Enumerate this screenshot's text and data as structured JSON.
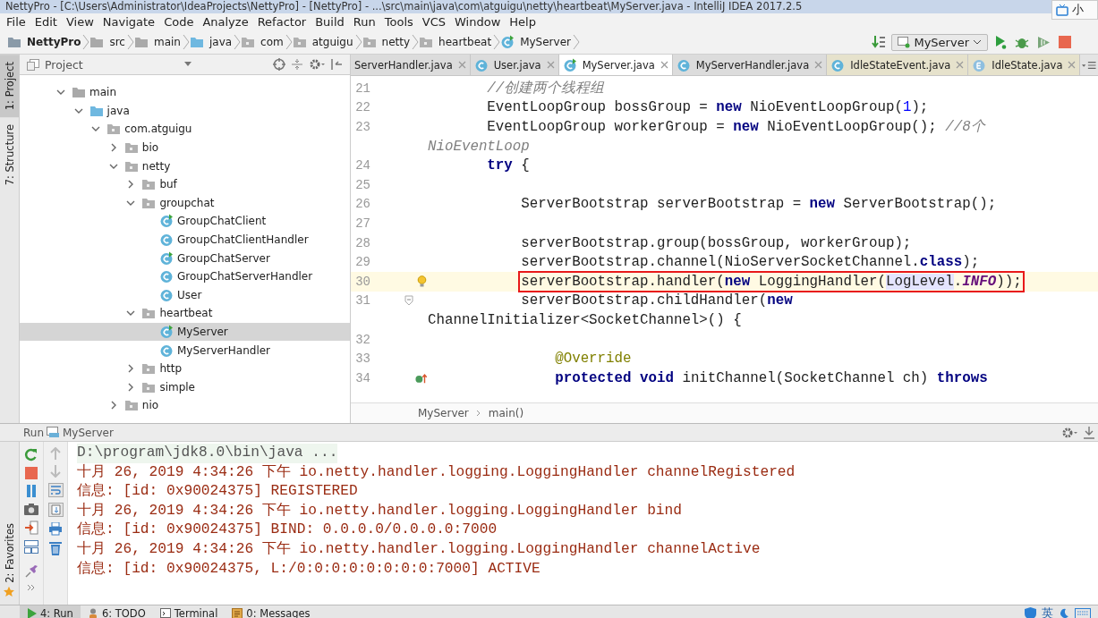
{
  "window": {
    "title": "NettyPro - [C:\\Users\\Administrator\\IdeaProjects\\NettyPro] - [NettyPro] - ...\\src\\main\\java\\com\\atguigu\\netty\\heartbeat\\MyServer.java - IntelliJ IDEA 2017.2.5",
    "popup": "小"
  },
  "menu": [
    "File",
    "Edit",
    "View",
    "Navigate",
    "Code",
    "Analyze",
    "Refactor",
    "Build",
    "Run",
    "Tools",
    "VCS",
    "Window",
    "Help"
  ],
  "breadcrumbs": [
    {
      "label": "NettyPro",
      "kind": "project"
    },
    {
      "label": "src",
      "kind": "folder"
    },
    {
      "label": "main",
      "kind": "folder"
    },
    {
      "label": "java",
      "kind": "source"
    },
    {
      "label": "com",
      "kind": "package"
    },
    {
      "label": "atguigu",
      "kind": "package"
    },
    {
      "label": "netty",
      "kind": "package"
    },
    {
      "label": "heartbeat",
      "kind": "package"
    },
    {
      "label": "MyServer",
      "kind": "main-class"
    }
  ],
  "run_config": "MyServer",
  "tool_tabs": [
    {
      "label": "1: Project",
      "selected": true
    },
    {
      "label": "7: Structure",
      "selected": false
    }
  ],
  "favorites_tab": "2: Favorites",
  "project": {
    "title": "Project",
    "tree": [
      {
        "label": "main",
        "kind": "folder",
        "expanded": true,
        "selected": false,
        "children": [
          {
            "label": "java",
            "kind": "source",
            "expanded": true,
            "selected": false,
            "children": [
              {
                "label": "com.atguigu",
                "kind": "package",
                "expanded": true,
                "selected": false,
                "children": [
                  {
                    "label": "bio",
                    "kind": "package",
                    "expanded": false,
                    "selected": false
                  },
                  {
                    "label": "netty",
                    "kind": "package",
                    "expanded": true,
                    "selected": false,
                    "children": [
                      {
                        "label": "buf",
                        "kind": "package",
                        "expanded": false,
                        "selected": false
                      },
                      {
                        "label": "groupchat",
                        "kind": "package",
                        "expanded": true,
                        "selected": false,
                        "children": [
                          {
                            "label": "GroupChatClient",
                            "kind": "main-class",
                            "selected": false
                          },
                          {
                            "label": "GroupChatClientHandler",
                            "kind": "class",
                            "selected": false
                          },
                          {
                            "label": "GroupChatServer",
                            "kind": "main-class",
                            "selected": false
                          },
                          {
                            "label": "GroupChatServerHandler",
                            "kind": "class",
                            "selected": false
                          },
                          {
                            "label": "User",
                            "kind": "class",
                            "selected": false
                          }
                        ]
                      },
                      {
                        "label": "heartbeat",
                        "kind": "package",
                        "expanded": true,
                        "selected": false,
                        "children": [
                          {
                            "label": "MyServer",
                            "kind": "main-class",
                            "selected": true
                          },
                          {
                            "label": "MyServerHandler",
                            "kind": "class",
                            "selected": false
                          }
                        ]
                      },
                      {
                        "label": "http",
                        "kind": "package",
                        "expanded": false,
                        "selected": false
                      },
                      {
                        "label": "simple",
                        "kind": "package",
                        "expanded": false,
                        "selected": false
                      }
                    ]
                  },
                  {
                    "label": "nio",
                    "kind": "package",
                    "expanded": false,
                    "selected": false
                  }
                ]
              }
            ]
          }
        ]
      }
    ]
  },
  "editor_tabs": [
    {
      "label": "ServerHandler.java",
      "kind": "none",
      "library": false,
      "selected": false
    },
    {
      "label": "User.java",
      "kind": "class",
      "library": false,
      "selected": false
    },
    {
      "label": "MyServer.java",
      "kind": "main-class",
      "library": false,
      "selected": true
    },
    {
      "label": "MyServerHandler.java",
      "kind": "class",
      "library": false,
      "selected": false
    },
    {
      "label": "IdleStateEvent.java",
      "kind": "class",
      "library": true,
      "selected": false
    },
    {
      "label": "IdleState.java",
      "kind": "enum",
      "library": true,
      "selected": false
    }
  ],
  "code": [
    {
      "number": "21",
      "current": false,
      "boxed": false,
      "tokens": [
        {
          "text": "       //创建两个线程组",
          "kind": "comment"
        }
      ]
    },
    {
      "number": "22",
      "current": false,
      "boxed": false,
      "tokens": [
        {
          "text": "       EventLoopGroup bossGroup = ",
          "kind": "plain"
        },
        {
          "text": "new",
          "kind": "keyword"
        },
        {
          "text": " NioEventLoopGroup(",
          "kind": "plain"
        },
        {
          "text": "1",
          "kind": "number"
        },
        {
          "text": ");",
          "kind": "plain"
        }
      ]
    },
    {
      "number": "23",
      "current": false,
      "boxed": false,
      "tokens": [
        {
          "text": "       EventLoopGroup workerGroup = ",
          "kind": "plain"
        },
        {
          "text": "new",
          "kind": "keyword"
        },
        {
          "text": " NioEventLoopGroup(); ",
          "kind": "plain"
        },
        {
          "text": "//8个",
          "kind": "comment"
        }
      ]
    },
    {
      "current": false,
      "boxed": false,
      "tokens": [
        {
          "text": "NioEventLoop",
          "kind": "comment"
        }
      ]
    },
    {
      "number": "24",
      "current": false,
      "boxed": false,
      "tokens": [
        {
          "text": "       try",
          "kind": "keyword"
        },
        {
          "text": " {",
          "kind": "plain"
        }
      ]
    },
    {
      "number": "25",
      "current": false
    },
    {
      "number": "26",
      "current": false,
      "boxed": false,
      "tokens": [
        {
          "text": "           ServerBootstrap serverBootstrap = ",
          "kind": "plain"
        },
        {
          "text": "new",
          "kind": "keyword"
        },
        {
          "text": " ServerBootstrap();",
          "kind": "plain"
        }
      ]
    },
    {
      "number": "27",
      "current": false
    },
    {
      "number": "28",
      "current": false,
      "boxed": false,
      "tokens": [
        {
          "text": "           serverBootstrap.group(bossGroup, workerGroup);",
          "kind": "plain"
        }
      ]
    },
    {
      "number": "29",
      "current": false,
      "boxed": false,
      "tokens": [
        {
          "text": "           serverBootstrap.channel(NioServerSocketChannel.",
          "kind": "plain"
        },
        {
          "text": "class",
          "kind": "keyword"
        },
        {
          "text": ");",
          "kind": "plain"
        }
      ]
    },
    {
      "number": "30",
      "current": true,
      "boxed": true,
      "gutter_icon": {
        "kind": "bulb"
      },
      "tokens": [
        {
          "text": "           serverBootstrap.handler(",
          "kind": "plain"
        },
        {
          "text": "new",
          "kind": "keyword"
        },
        {
          "text": " LoggingHandler(",
          "kind": "plain"
        },
        {
          "text": "LogLevel",
          "kind": "usage"
        },
        {
          "text": ".",
          "kind": "plain"
        },
        {
          "text": "INFO",
          "kind": "constant"
        },
        {
          "text": "));",
          "kind": "plain"
        }
      ]
    },
    {
      "number": "31",
      "current": false,
      "boxed": false,
      "gutter_icon": {
        "kind": "fold"
      },
      "tokens": [
        {
          "text": "           serverBootstrap.childHandler(",
          "kind": "plain"
        },
        {
          "text": "new",
          "kind": "keyword"
        }
      ]
    },
    {
      "current": false,
      "boxed": false,
      "tokens": [
        {
          "text": "ChannelInitializer<SocketChannel>() {",
          "kind": "plain"
        }
      ]
    },
    {
      "number": "32",
      "current": false
    },
    {
      "number": "33",
      "current": false,
      "boxed": false,
      "tokens": [
        {
          "text": "               @Override",
          "kind": "annotation"
        }
      ]
    },
    {
      "number": "34",
      "current": false,
      "boxed": false,
      "gutter_icon": {
        "kind": "override"
      },
      "tokens": [
        {
          "text": "               protected void",
          "kind": "keyword"
        },
        {
          "text": " initChannel(SocketChannel ch) ",
          "kind": "plain"
        },
        {
          "text": "throws",
          "kind": "keyword"
        }
      ]
    }
  ],
  "editor_breadcrumbs": [
    "MyServer",
    "main()"
  ],
  "run": {
    "label": "Run",
    "config": "MyServer",
    "console": [
      {
        "text": "D:\\program\\jdk8.0\\bin\\java ...",
        "kind": "command"
      },
      {
        "text": "十月 26, 2019 4:34:26 下午 io.netty.handler.logging.LoggingHandler channelRegistered",
        "kind": "log"
      },
      {
        "text": "信息: [id: 0x90024375] REGISTERED",
        "kind": "log"
      },
      {
        "text": "十月 26, 2019 4:34:26 下午 io.netty.handler.logging.LoggingHandler bind",
        "kind": "log"
      },
      {
        "text": "信息: [id: 0x90024375] BIND: 0.0.0.0/0.0.0.0:7000",
        "kind": "log"
      },
      {
        "text": "十月 26, 2019 4:34:26 下午 io.netty.handler.logging.LoggingHandler channelActive",
        "kind": "log"
      },
      {
        "text": "信息: [id: 0x90024375, L:/0:0:0:0:0:0:0:0:7000] ACTIVE",
        "kind": "log"
      }
    ]
  },
  "bottom_tabs": [
    {
      "label": "4: Run",
      "kind": "run",
      "selected": true
    },
    {
      "label": "6: TODO",
      "kind": "todo",
      "selected": false
    },
    {
      "label": "Terminal",
      "kind": "terminal",
      "selected": false
    },
    {
      "label": "0: Messages",
      "kind": "messages",
      "selected": false
    }
  ],
  "tray": {
    "ime": "英"
  }
}
